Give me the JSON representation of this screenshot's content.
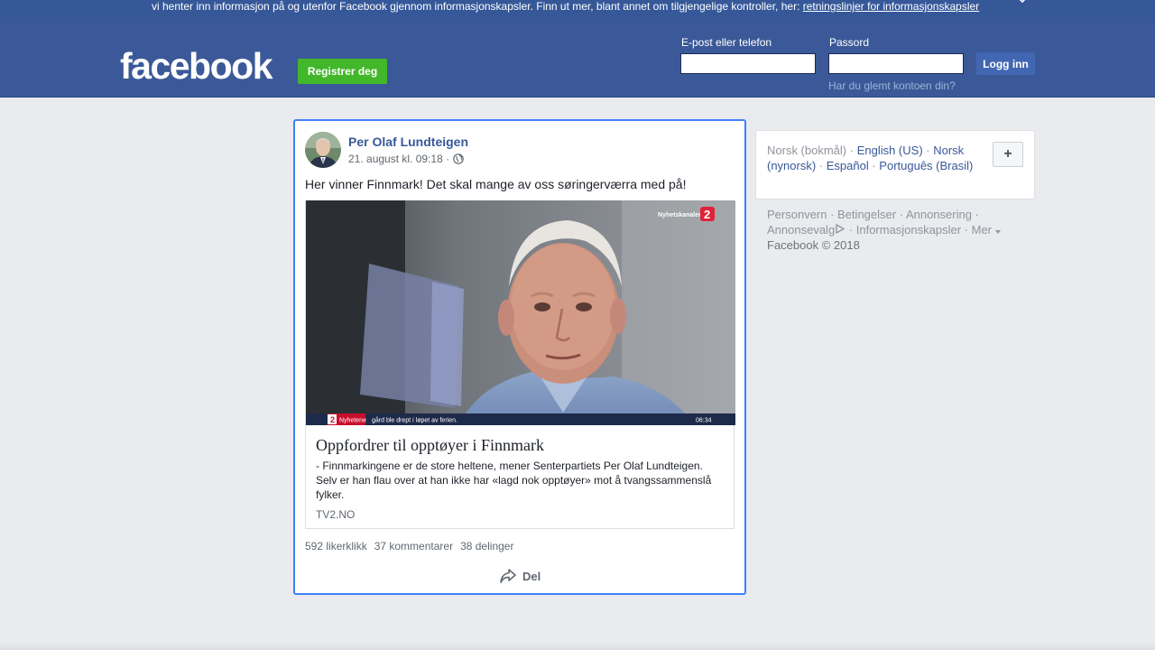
{
  "cookie_banner": {
    "text": "vi henter inn informasjon på og utenfor Facebook gjennom informasjonskapsler. Finn ut mer, blant annet om tilgjengelige kontroller, her: ",
    "link": "retningslinjer for informasjonskapsler"
  },
  "header": {
    "logo": "facebook",
    "register_label": "Registrer deg",
    "email_label": "E-post eller telefon",
    "email_value": "",
    "password_label": "Passord",
    "password_value": "",
    "login_label": "Logg inn",
    "forgot_label": "Har du glemt kontoen din?"
  },
  "post": {
    "author": "Per Olaf Lundteigen",
    "date": "21. august kl. 09:18 ·",
    "privacy_icon": "globe-icon",
    "text": "Her vinner Finnmark! Det skal mange av oss søringerværra med på!",
    "link": {
      "image_overlay": {
        "channel": "Nyhetskanalen",
        "channel_number": "2",
        "ticker_label": "Nyhetene",
        "ticker_text": "gård ble drept i løpet av ferien.",
        "time": "06:34"
      },
      "title": "Oppfordrer til opptøyer i Finnmark",
      "description": "- Finnmarkingene er de store heltene, mener Senterpartiets Per Olaf Lundteigen. Selv er han flau over at han ikke har «lagd nok opptøyer» mot å tvangssammenslå fylker.",
      "source": "TV2.NO"
    },
    "stats": {
      "likes": "592 likerklikk",
      "comments": "37 kommentarer",
      "shares": "38 delinger"
    },
    "share_label": "Del"
  },
  "languages": {
    "current": "Norsk (bokmål)",
    "options": [
      "English (US)",
      "Norsk (nynorsk)",
      "Español",
      "Português (Brasil)"
    ],
    "add_label": "+"
  },
  "footer": {
    "links": [
      "Personvern",
      "Betingelser",
      "Annonsering",
      "Annonsevalg",
      "Informasjonskapsler",
      "Mer"
    ],
    "copyright": "Facebook © 2018"
  },
  "colors": {
    "brand_blue": "#3b5998",
    "register_green": "#42b72a",
    "link_blue": "#385898",
    "focus_border": "#4080ff"
  }
}
